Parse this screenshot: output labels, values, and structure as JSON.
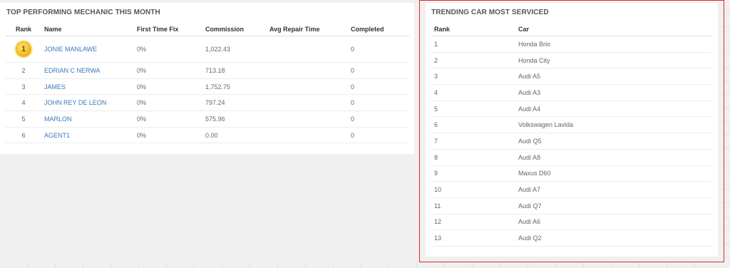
{
  "mechanics": {
    "title": "TOP PERFORMING MECHANIC THIS MONTH",
    "columns": [
      "Rank",
      "Name",
      "First Time Fix",
      "Commission",
      "Avg Repair Time",
      "Completed"
    ],
    "rows": [
      {
        "rank": "1",
        "name": "JONIE MANLAWE",
        "first_time_fix": "0%",
        "commission": "1,022.43",
        "avg_repair_time": "",
        "completed": "0"
      },
      {
        "rank": "2",
        "name": "EDRIAN C NERWA",
        "first_time_fix": "0%",
        "commission": "713.18",
        "avg_repair_time": "",
        "completed": "0"
      },
      {
        "rank": "3",
        "name": "JAMES",
        "first_time_fix": "0%",
        "commission": "1,752.75",
        "avg_repair_time": "",
        "completed": "0"
      },
      {
        "rank": "4",
        "name": "JOHN REY DE LEON",
        "first_time_fix": "0%",
        "commission": "797.24",
        "avg_repair_time": "",
        "completed": "0"
      },
      {
        "rank": "5",
        "name": "MARLON",
        "first_time_fix": "0%",
        "commission": "575.96",
        "avg_repair_time": "",
        "completed": "0"
      },
      {
        "rank": "6",
        "name": "AGENT1",
        "first_time_fix": "0%",
        "commission": "0.00",
        "avg_repair_time": "",
        "completed": "0"
      }
    ]
  },
  "cars": {
    "title": "TRENDING CAR MOST SERVICED",
    "columns": [
      "Rank",
      "Car"
    ],
    "rows": [
      {
        "rank": "1",
        "car": "Honda Brio"
      },
      {
        "rank": "2",
        "car": "Honda City"
      },
      {
        "rank": "3",
        "car": "Audi A5"
      },
      {
        "rank": "4",
        "car": "Audi A3"
      },
      {
        "rank": "5",
        "car": "Audi A4"
      },
      {
        "rank": "6",
        "car": "Volkswagen Lavida"
      },
      {
        "rank": "7",
        "car": "Audi Q5"
      },
      {
        "rank": "8",
        "car": "Audi A8"
      },
      {
        "rank": "9",
        "car": "Maxus D60"
      },
      {
        "rank": "10",
        "car": "Audi A7"
      },
      {
        "rank": "11",
        "car": "Audi Q7"
      },
      {
        "rank": "12",
        "car": "Audi A6"
      },
      {
        "rank": "13",
        "car": "Audi Q2"
      }
    ]
  },
  "icons": {
    "medal": "gold-medal-icon"
  },
  "colors": {
    "link": "#3a79b8",
    "highlight_border": "#e0282a",
    "medal_gold": "#f5c22c"
  }
}
